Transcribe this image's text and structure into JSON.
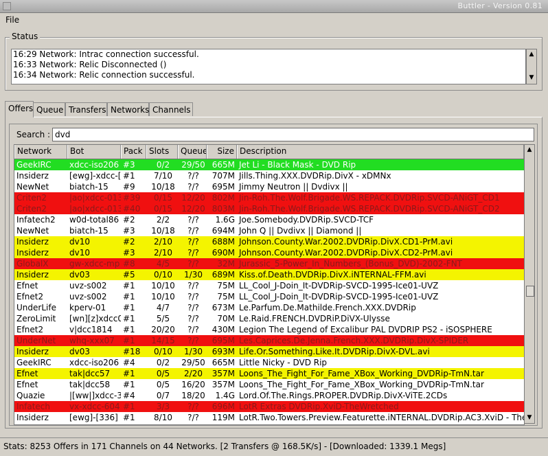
{
  "window": {
    "title": "Buttler - Version 0.81"
  },
  "menu": {
    "file": "File"
  },
  "status": {
    "legend": "Status",
    "lines": [
      "16:29 Network: Intrac connection successful.",
      "16:33 Network: Relic Disconnected ()",
      "16:34 Network: Relic connection successful."
    ]
  },
  "tabs": [
    "Offers",
    "Queue",
    "Transfers",
    "Networks",
    "Channels"
  ],
  "search": {
    "label": "Search :",
    "value": "dvd"
  },
  "table": {
    "columns": [
      "Network",
      "Bot",
      "Pack",
      "Slots",
      "Queue",
      "Size",
      "Description"
    ],
    "rows": [
      {
        "hl": "g",
        "cells": [
          "GeekIRC",
          "xdcc-iso206",
          "#3",
          "0/2",
          "29/50",
          "665M",
          "Jet Li - Black Mask - DVD Rip"
        ]
      },
      {
        "hl": "w",
        "cells": [
          "Insiderz",
          "[ewg]-xdcc-[",
          "#1",
          "7/10",
          "?/?",
          "707M",
          "Jills.Thing.XXX.DVDRip.DivX - xDMNx"
        ]
      },
      {
        "hl": "w",
        "cells": [
          "NewNet",
          "biatch-15",
          "#9",
          "10/18",
          "?/?",
          "695M",
          "Jimmy Neutron || Dvdivx ||"
        ]
      },
      {
        "hl": "r",
        "cells": [
          "Criten2",
          "|ao|xdcc-013",
          "#39",
          "0/15",
          "12/20",
          "802M",
          "Jin-Roh.The.Wolf.Brigade.WS.REPACK.DVDRip.SVCD-ANiGT_CD1"
        ]
      },
      {
        "hl": "r",
        "cells": [
          "Criten2",
          "|ao|xdcc-013",
          "#40",
          "0/15",
          "12/20",
          "803M",
          "Jin-Roh.The.Wolf.Brigade.WS.REPACK.DVDRip.SVCD-ANiGT_CD2"
        ]
      },
      {
        "hl": "w",
        "cells": [
          "Infatech2",
          "w0d-total86",
          "#2",
          "2/2",
          "?/?",
          "1.6G",
          "Joe.Somebody.DVDRip.SVCD-TCF"
        ]
      },
      {
        "hl": "w",
        "cells": [
          "NewNet",
          "biatch-15",
          "#3",
          "10/18",
          "?/?",
          "694M",
          "John Q || Dvdivx || Diamond ||"
        ]
      },
      {
        "hl": "y",
        "cells": [
          "Insiderz",
          "dv10",
          "#2",
          "2/10",
          "?/?",
          "688M",
          "Johnson.County.War.2002.DVDRip.DivX.CD1-PrM.avi"
        ]
      },
      {
        "hl": "y",
        "cells": [
          "Insiderz",
          "dv10",
          "#3",
          "2/10",
          "?/?",
          "690M",
          "Johnson.County.War.2002.DVDRip.DivX.CD2-PrM.avi"
        ]
      },
      {
        "hl": "r",
        "cells": [
          "GlobalX",
          "gw-xdcc-mp",
          "#8",
          "4/5",
          "?/?",
          "32M",
          "Jurassic_5-Power_In_Numbers_(Bonus_DVD)-2002-FNT"
        ]
      },
      {
        "hl": "y",
        "cells": [
          "Insiderz",
          "dv03",
          "#5",
          "0/10",
          "1/30",
          "689M",
          "Kiss.of.Death.DVDRip.DivX.iNTERNAL-FFM.avi"
        ]
      },
      {
        "hl": "w",
        "cells": [
          "Efnet",
          "uvz-s002",
          "#1",
          "10/10",
          "?/?",
          "75M",
          "LL_Cool_J-Doin_It-DVDRip-SVCD-1995-Ice01-UVZ"
        ]
      },
      {
        "hl": "w",
        "cells": [
          "Efnet2",
          "uvz-s002",
          "#1",
          "10/10",
          "?/?",
          "75M",
          "LL_Cool_J-Doin_It-DVDRip-SVCD-1995-Ice01-UVZ"
        ]
      },
      {
        "hl": "w",
        "cells": [
          "UnderLife",
          "kperv-01",
          "#1",
          "4/7",
          "?/?",
          "673M",
          "Le.Parfum.De.Mathilde.French.XXX.DVDRip"
        ]
      },
      {
        "hl": "w",
        "cells": [
          "ZeroLimit",
          "[wn][z]xdcc0",
          "#1",
          "5/5",
          "?/?",
          "70M",
          "Le.Raid.FRENCH.DVDRiP.DiVX-Ulysse"
        ]
      },
      {
        "hl": "w",
        "cells": [
          "Efnet2",
          "v|dcc1814",
          "#1",
          "20/20",
          "?/?",
          "430M",
          "Legion The Legend of Excalibur PAL DVDRIP PS2 - iSOSPHERE"
        ]
      },
      {
        "hl": "r",
        "cells": [
          "UnderNet",
          "whq-xxx07",
          "#1",
          "14/15",
          "?/?",
          "695M",
          "Les.Caprices.De.Jenna.French.XXX.DVDRip.DivX-SPIDER"
        ]
      },
      {
        "hl": "y",
        "cells": [
          "Insiderz",
          "dv03",
          "#18",
          "0/10",
          "1/30",
          "693M",
          "Life.Or.Something.Like.It.DVDRip.DivX-DVL.avi"
        ]
      },
      {
        "hl": "w",
        "cells": [
          "GeekIRC",
          "xdcc-iso206",
          "#4",
          "0/2",
          "29/50",
          "665M",
          "Little Nicky - DVD Rip"
        ]
      },
      {
        "hl": "y",
        "cells": [
          "Efnet",
          "tak|dcc57",
          "#1",
          "0/5",
          "2/20",
          "357M",
          "Loons_The_Fight_For_Fame_XBox_Working_DVDRip-TmN.tar"
        ]
      },
      {
        "hl": "w",
        "cells": [
          "Efnet",
          "tak|dcc58",
          "#1",
          "0/5",
          "16/20",
          "357M",
          "Loons_The_Fight_For_Fame_XBox_Working_DVDRip-TmN.tar"
        ]
      },
      {
        "hl": "w",
        "cells": [
          "Quazie",
          "|[ww|]xdcc-3",
          "#4",
          "0/7",
          "18/20",
          "1.4G",
          "Lord.Of.The.Rings.PROPER.DVDRip.DivX-ViTE.2CDs"
        ]
      },
      {
        "hl": "r",
        "cells": [
          "Infatech",
          "vx-xdcc-604",
          "#1",
          "3/3",
          "?/?",
          "696M",
          "LotR Extras DVDRip.XviD-TheWretched"
        ]
      },
      {
        "hl": "w",
        "cells": [
          "Insiderz",
          "[ewg]-[336]",
          "#1",
          "8/10",
          "?/?",
          "119M",
          "LotR.Two.Towers.Preview.Featurette.iNTERNAL.DVDRip.AC3.XviD - The"
        ]
      }
    ]
  },
  "statusbar": {
    "text": "Stats: 8253 Offers in 171 Channels on 44 Networks. [2 Transfers @ 168.5K/s] - [Downloaded: 1339.1 Megs]"
  }
}
